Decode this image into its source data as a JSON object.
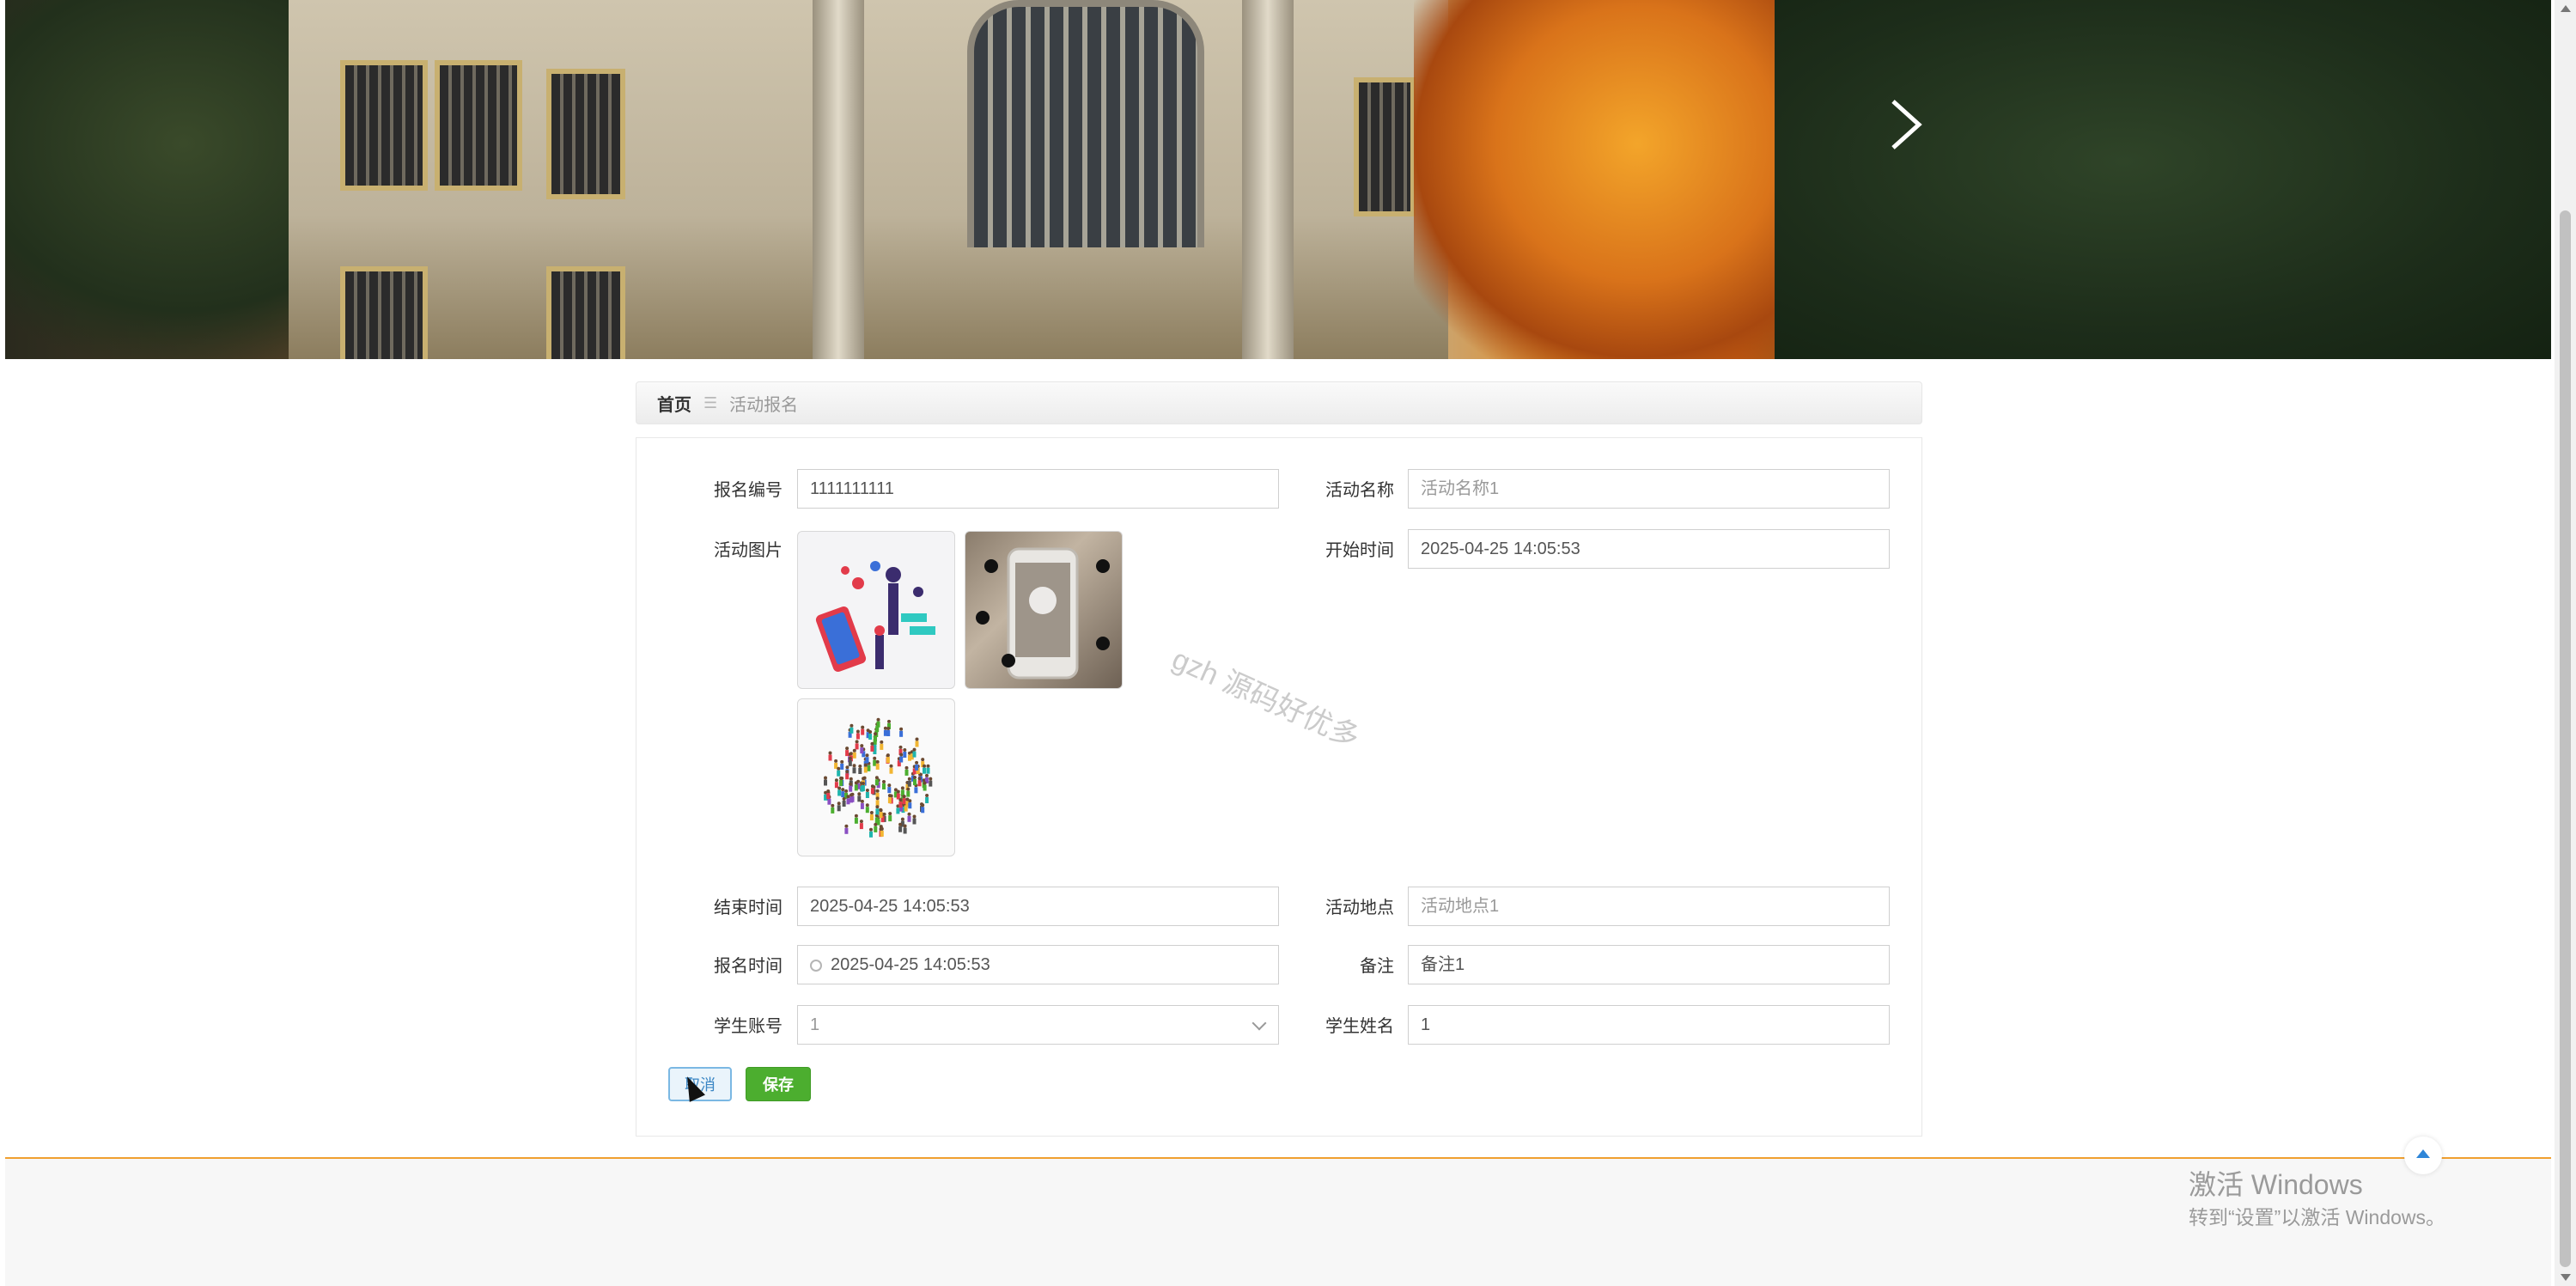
{
  "breadcrumb": {
    "home": "首页",
    "separator": "☰",
    "current": "活动报名"
  },
  "form": {
    "baoming_bianhao": {
      "label": "报名编号",
      "value": "1111111111"
    },
    "huodong_mingcheng": {
      "label": "活动名称",
      "placeholder": "活动名称1"
    },
    "huodong_tupian": {
      "label": "活动图片"
    },
    "kaishi_shijian": {
      "label": "开始时间",
      "value": "2025-04-25 14:05:53"
    },
    "jieshu_shijian": {
      "label": "结束时间",
      "value": "2025-04-25 14:05:53"
    },
    "huodong_didian": {
      "label": "活动地点",
      "placeholder": "活动地点1"
    },
    "baoming_shijian": {
      "label": "报名时间",
      "value": "2025-04-25 14:05:53"
    },
    "beizhu": {
      "label": "备注",
      "value": "备注1"
    },
    "xuesheng_zhanghao": {
      "label": "学生账号",
      "value": "1"
    },
    "xuesheng_xingming": {
      "label": "学生姓名",
      "value": "1"
    }
  },
  "buttons": {
    "cancel": "取消",
    "save": "保存"
  },
  "watermark": "gzh 源码好优多",
  "windows_activation": {
    "title": "激活 Windows",
    "subtitle": "转到“设置”以激活 Windows。"
  },
  "colors": {
    "save_green": "#4cae2f",
    "footer_accent": "#f0a030",
    "cancel_blue": "#3a86c4"
  }
}
